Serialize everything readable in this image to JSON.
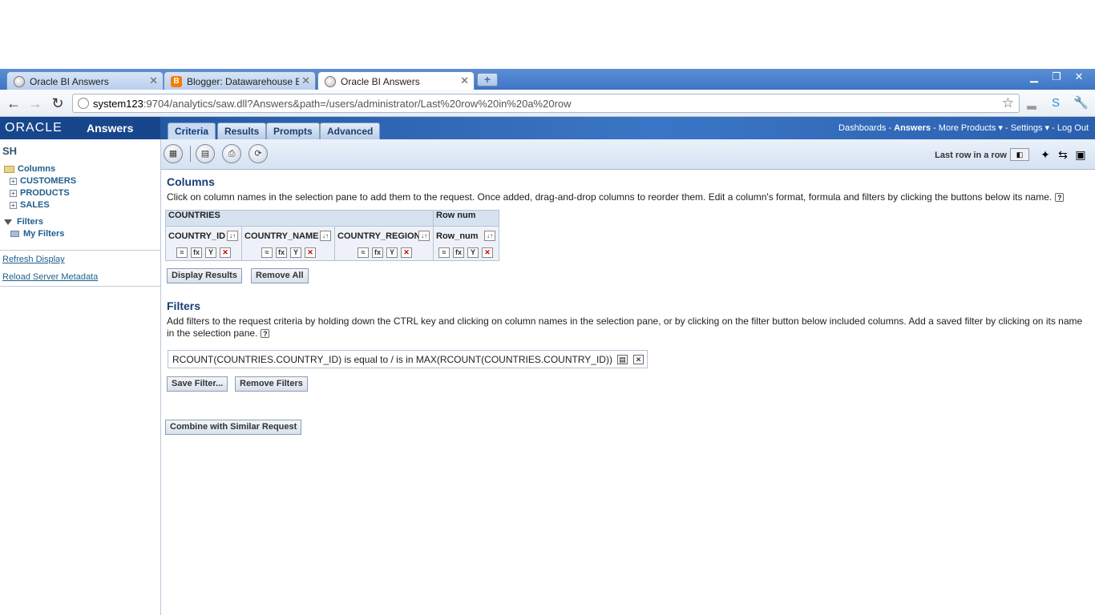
{
  "browser": {
    "tabs": [
      {
        "title": "Oracle BI Answers",
        "icon": "globe-icon"
      },
      {
        "title": "Blogger: Datawarehouse BI - (",
        "icon": "blogger-icon"
      },
      {
        "title": "Oracle BI Answers",
        "icon": "globe-icon"
      }
    ],
    "url_host": "system123",
    "url_rest": ":9704/analytics/saw.dll?Answers&path=/users/administrator/Last%20row%20in%20a%20row"
  },
  "header": {
    "brand": "ORACLE",
    "product": "Answers",
    "tabs": [
      "Criteria",
      "Results",
      "Prompts",
      "Advanced"
    ],
    "links": {
      "dashboards": "Dashboards",
      "sep": "-",
      "answers": "Answers",
      "more_products": "More Products",
      "settings": "Settings",
      "logout": "Log Out"
    }
  },
  "left": {
    "subject_area": "SH",
    "columns_label": "Columns",
    "folders": [
      "CUSTOMERS",
      "PRODUCTS",
      "SALES"
    ],
    "filters_label": "Filters",
    "my_filters": "My Filters",
    "refresh": "Refresh Display",
    "reload": "Reload Server Metadata"
  },
  "toolbar": {
    "request_name": "Last row in a row"
  },
  "columns": {
    "heading": "Columns",
    "description": "Click on column names in the selection pane to add them to the request. Once added, drag-and-drop columns to reorder them. Edit a column's format, formula and filters by clicking the buttons below its name.",
    "groups": [
      {
        "name": "COUNTRIES",
        "cols": [
          "COUNTRY_ID",
          "COUNTRY_NAME",
          "COUNTRY_REGION"
        ]
      },
      {
        "name": "Row num",
        "cols": [
          "Row_num"
        ]
      }
    ],
    "display_results": "Display Results",
    "remove_all": "Remove All"
  },
  "filters": {
    "heading": "Filters",
    "description": "Add filters to the request criteria by holding down the CTRL key and clicking on column names in the selection pane, or by clicking on the filter button below included columns. Add a saved filter by clicking on its name in the selection pane.",
    "filter_text": "RCOUNT(COUNTRIES.COUNTRY_ID) is equal to / is in MAX(RCOUNT(COUNTRIES.COUNTRY_ID))",
    "save_filter": "Save Filter...",
    "remove_filters": "Remove Filters"
  },
  "combine": "Combine with Similar Request"
}
